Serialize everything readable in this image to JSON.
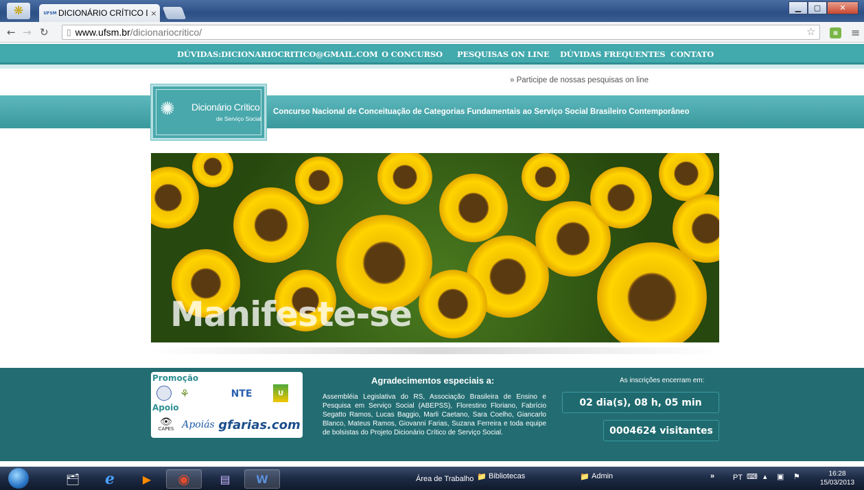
{
  "browser": {
    "tab_title": "DICIONÁRIO CRÍTICO DE",
    "tab_close": "×",
    "url_host": "www.ufsm.br",
    "url_path": "/dicionariocritico/",
    "favicon_text": "UFSM"
  },
  "site": {
    "nav": [
      {
        "label": "DÚVIDAS:DICIONARIOCRITICO@GMAIL.COM"
      },
      {
        "label": "O CONCURSO"
      },
      {
        "label": "PESQUISAS ON LINE"
      },
      {
        "label": "DÚVIDAS FREQUENTES"
      },
      {
        "label": "CONTATO"
      }
    ],
    "participe": "» Participe de nossas pesquisas on line",
    "logo_title": "Dicionário Crítico",
    "logo_subtitle": "de Serviço Social",
    "tagline": "Concurso Nacional de Conceituação de Categorias Fundamentais ao Serviço Social Brasileiro Contemporâneo",
    "banner_text": "Manifeste-se"
  },
  "footer": {
    "promocao_label": "Promoção",
    "apoio_label": "Apoio",
    "nte_text": "NTE",
    "capes_text": "CAPES",
    "apoio_text": "Apoiás",
    "gfarias_text": "gfarias.com",
    "thanks_title": "Agradecimentos especiais a:",
    "thanks_body": "Assembléia Legislativa do RS, Associação Brasileira de Ensino e Pesquisa em Serviço Social (ABEPSS), Florestino Floriano, Fabrício Segatto Ramos, Lucas Baggio, Marli Caetano, Sara Coelho, Giancarlo Blanco, Mateus Ramos, Giovanni Farias, Suzana Ferreira e toda equipe de bolsistas do Projeto Dicionário Crítico de Serviço Social.",
    "inscricoes_label": "As inscrições encerram em:",
    "countdown": "02 dia(s), 08 h, 05 min",
    "visitors": "0004624 visitantes"
  },
  "taskbar": {
    "desktop_label": "Área de Trabalho",
    "bibliotecas_label": "Bibliotecas",
    "admin_label": "Admin",
    "lang": "PT",
    "time": "16:28",
    "date": "15/03/2013"
  }
}
